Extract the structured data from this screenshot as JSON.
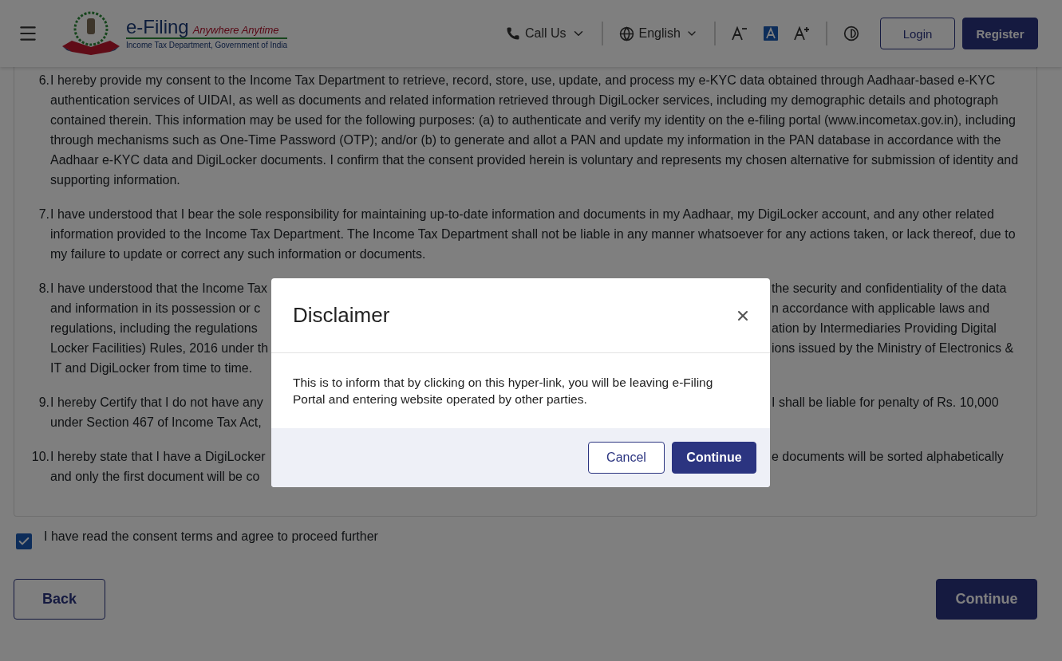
{
  "header": {
    "logo": {
      "title": "e-Filing",
      "tagline": "Anywhere Anytime",
      "subtitle": "Income Tax Department, Government of India"
    },
    "call_us": "Call Us",
    "language": "English",
    "login": "Login",
    "register": "Register"
  },
  "consent_items": [
    {
      "number": "6.",
      "kind": "full",
      "text": "I hereby provide my consent to the Income Tax Department to retrieve, record, store, use, update, and process my e-KYC data obtained through Aadhaar-based e-KYC authentication services of UIDAI, as well as documents and related information retrieved through DigiLocker services, including my demographic details and photograph contained therein. This information may be used for the following purposes: (a) to authenticate and verify my identity on the e-filing portal (www.incometax.gov.in), including through mechanisms such as One-Time Password (OTP); and/or (b) to generate and allot a PAN and update my information in the PAN database in accordance with the Aadhaar e-KYC data and DigiLocker documents. I confirm that the consent provided herein is voluntary and represents my chosen alternative for submission of identity and supporting information."
    },
    {
      "number": "7.",
      "kind": "full",
      "text": "I have understood that I bear the sole responsibility for maintaining up-to-date information and documents in my Aadhaar, my DigiLocker account, and any other related information provided to the Income Tax Department. The Income Tax Department shall not be liable in any manner whatsoever for any actions taken, or lack thereof, due to my failure to update or correct any such information or documents."
    },
    {
      "number": "8.",
      "kind": "split",
      "lines": [
        {
          "left": "I have understood that the Income Tax",
          "right": "the security and confidentiality of the data"
        },
        {
          "left": "and information in its possession or c",
          "right": "n accordance with applicable laws and"
        },
        {
          "left": "regulations, including the regulations",
          "right": "ation by Intermediaries Providing Digital"
        },
        {
          "left": "Locker Facilities) Rules, 2016 under th",
          "right": "ions issued by the Ministry of Electronics &"
        },
        {
          "left": "IT and DigiLocker from time to time."
        }
      ]
    },
    {
      "number": "9.",
      "kind": "split",
      "lines": [
        {
          "left": "I hereby Certify that I do not have any",
          "right": "I shall be liable for penalty of Rs. 10,000"
        },
        {
          "left": "under Section 467 of Income Tax Act,"
        }
      ]
    },
    {
      "number": "10.",
      "kind": "split",
      "lines": [
        {
          "left": "I hereby state that I have a DigiLocker",
          "right": "e documents will be sorted alphabetically"
        },
        {
          "left": "and only the first document will be co"
        }
      ]
    }
  ],
  "agree": {
    "label": "I have read the consent terms and agree to proceed further",
    "checked": true
  },
  "back": "Back",
  "continue": "Continue",
  "dialog": {
    "title": "Disclaimer",
    "message": "This is to inform that by clicking on this hyper-link, you will be leaving e-Filing Portal and entering website operated by other parties.",
    "cancel": "Cancel",
    "continue": "Continue"
  }
}
